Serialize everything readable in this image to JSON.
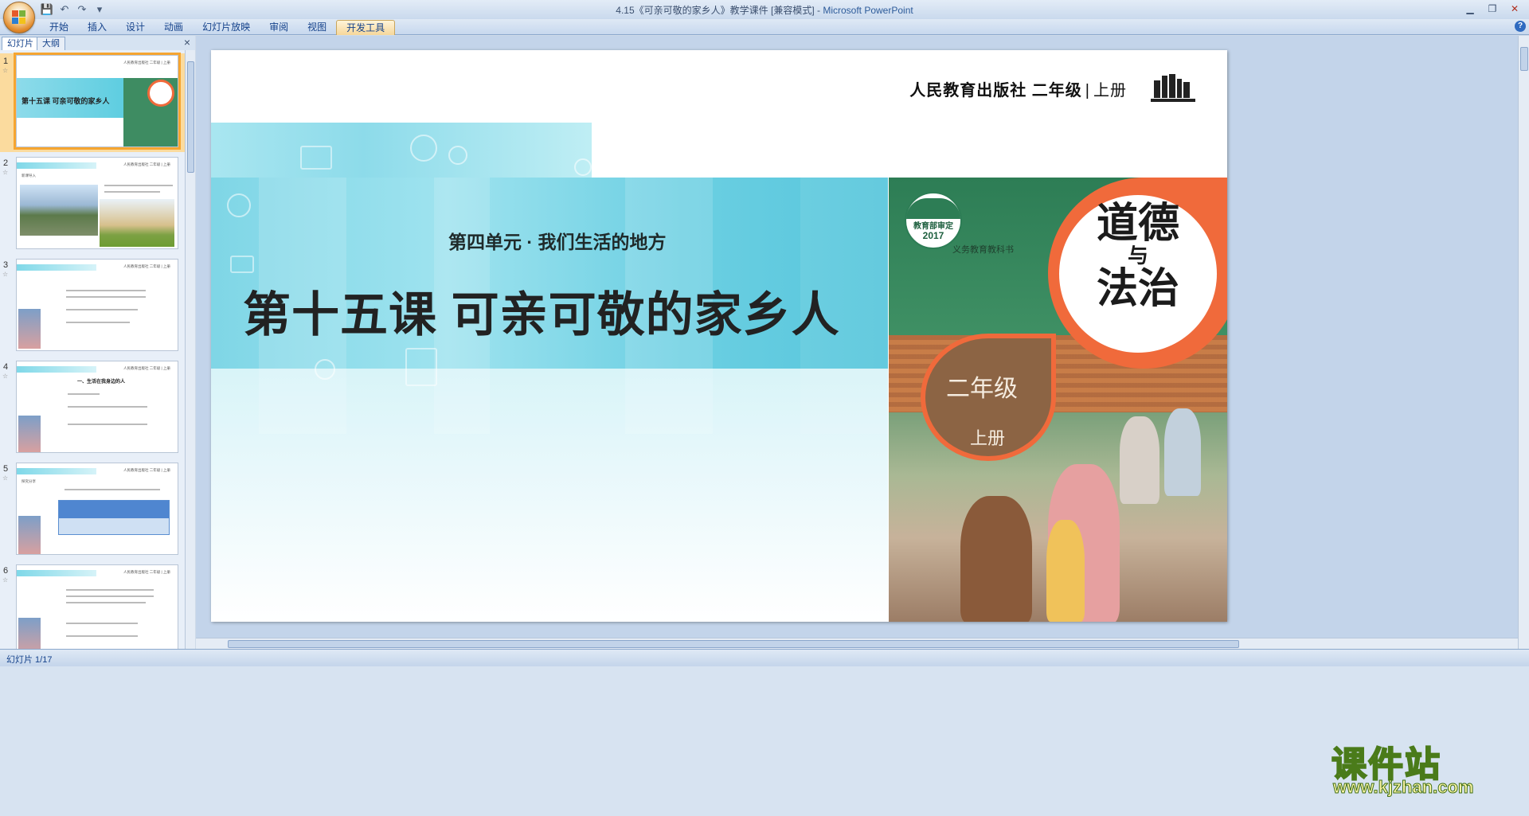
{
  "window": {
    "title_doc": "4.15《可亲可敬的家乡人》教学课件 [兼容模式] - ",
    "title_app": "Microsoft PowerPoint"
  },
  "ribbon": {
    "tabs": [
      "开始",
      "插入",
      "设计",
      "动画",
      "幻灯片放映",
      "审阅",
      "视图",
      "开发工具"
    ],
    "active_tab": "开发工具"
  },
  "pane": {
    "tab_slides": "幻灯片",
    "tab_outline": "大纲",
    "close": "×"
  },
  "thumbnails": [
    {
      "num": "1",
      "title": "第十五课 可亲可敬的家乡人",
      "small": "人民教育出版社 二年级 | 上册"
    },
    {
      "num": "2",
      "title": "新课导入",
      "small": "人民教育出版社 二年级 | 上册"
    },
    {
      "num": "3",
      "title": "",
      "small": "人民教育出版社 二年级 | 上册"
    },
    {
      "num": "4",
      "title": "一、生活在我身边的人",
      "small": "人民教育出版社 二年级 | 上册"
    },
    {
      "num": "5",
      "title": "探究分享",
      "small": "人民教育出版社 二年级 | 上册"
    },
    {
      "num": "6",
      "title": "",
      "small": "人民教育出版社 二年级 | 上册"
    }
  ],
  "slide": {
    "publisher": "人民教育出版社 二年级",
    "separator": "|",
    "volume_label": "上册",
    "unit_title": "第四单元 · 我们生活的地方",
    "lesson_title": "第十五课 可亲可敬的家乡人",
    "cover": {
      "seal_line1": "教育部审定",
      "seal_line2": "2017",
      "series": "义务教育教科书",
      "title_1": "道德",
      "title_2": "与",
      "title_3": "法治",
      "grade": "二年级",
      "volume": "上册"
    }
  },
  "status": {
    "slide_counter": "幻灯片 1/17"
  },
  "watermark": {
    "cn": "课件站",
    "url": "www.kjzhan.com"
  },
  "colors": {
    "accent_teal": "#57c6dc",
    "cover_green": "#3e8c62",
    "cover_orange": "#f06a3b",
    "selection": "#f6a530"
  }
}
